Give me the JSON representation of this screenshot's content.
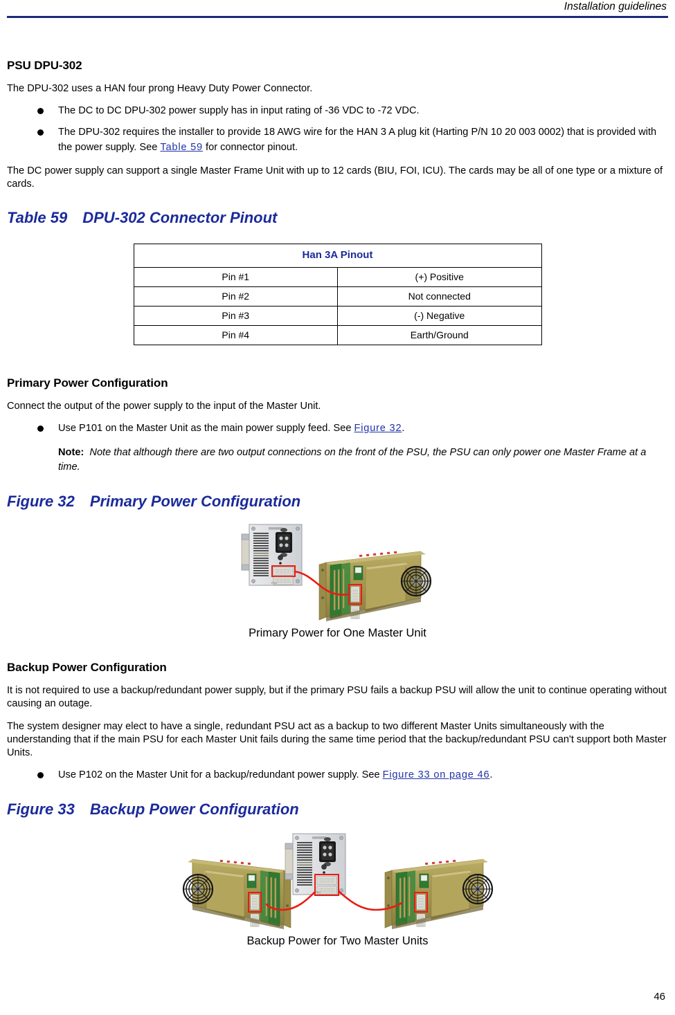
{
  "header": {
    "title": "Installation guidelines"
  },
  "sections": {
    "psu": {
      "heading": "PSU DPU-302",
      "intro": "The DPU-302 uses a HAN four prong Heavy Duty Power Connector.",
      "bullets": [
        {
          "before": "The DC to DC DPU-302 power supply has in input rating of -36 VDC to -72 VDC.",
          "link": "",
          "after": ""
        },
        {
          "before": "The DPU-302 requires the installer to provide 18 AWG wire for the HAN 3 A plug kit (Harting P/N 10 20 003 0002) that is provided with the power supply. See ",
          "link": "Table 59",
          "after": " for connector pinout."
        }
      ],
      "closing": "The DC power supply can support a single Master Frame Unit with up to 12 cards (BIU, FOI, ICU). The cards may be all of one type or a mixture of cards."
    },
    "primary": {
      "heading": "Primary Power Configuration",
      "intro": "Connect the output of the power supply to the input of the Master Unit.",
      "bullet": {
        "before": "Use P101 on the Master Unit as the main power supply feed. See ",
        "link": "Figure 32",
        "after": "."
      },
      "note_label": "Note:",
      "note_text": "Note that although there are two output connections on the front of the PSU, the PSU can only power one Master Frame at a time."
    },
    "backup": {
      "heading": "Backup Power Configuration",
      "para1": "It is not required to use a backup/redundant power supply, but if the primary PSU fails a backup PSU will allow the unit to continue operating without causing an outage.",
      "para2": "The system designer may elect to have a single, redundant PSU act as a backup to two different Master Units simultaneously with the understanding that if the main PSU for each Master Unit fails during the same time period that the backup/redundant PSU can't support both Master Units.",
      "bullet": {
        "before": "Use P102 on the Master Unit for a backup/redundant power supply. See ",
        "link": "Figure 33 on page 46",
        "after": "."
      }
    }
  },
  "table59": {
    "caption_number": "Table 59",
    "caption_title": "DPU-302 Connector Pinout",
    "header": "Han 3A Pinout",
    "rows": [
      {
        "pin": "Pin #1",
        "function": "(+) Positive"
      },
      {
        "pin": "Pin #2",
        "function": "Not connected"
      },
      {
        "pin": "Pin #3",
        "function": "(-) Negative"
      },
      {
        "pin": "Pin #4",
        "function": "Earth/Ground"
      }
    ]
  },
  "figure32": {
    "caption_number": "Figure 32",
    "caption_title": "Primary Power Configuration",
    "sub_caption": "Primary Power for One Master Unit"
  },
  "figure33": {
    "caption_number": "Figure 33",
    "caption_title": "Backup Power Configuration",
    "sub_caption": "Backup Power for Two Master Units"
  },
  "footer": {
    "page_number": "46"
  },
  "colors": {
    "rule": "#1b2a7a",
    "caption_blue": "#1b2a9b",
    "link_blue": "#2032a8",
    "cable_red": "#e81c12",
    "chassis_gold": "#a99a52",
    "pcb_green": "#2f7a33"
  }
}
